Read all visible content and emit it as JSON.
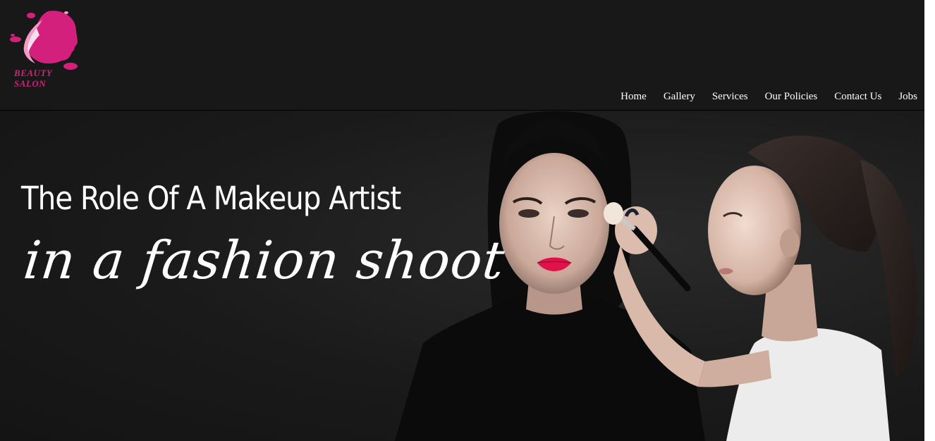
{
  "logo": {
    "icon": "woman-profile-icon",
    "line1": "BEAUTY",
    "line2": "SALON",
    "color": "#d2207c"
  },
  "nav": {
    "items": [
      "Home",
      "Gallery",
      "Services",
      "Our Policies",
      "Contact Us",
      "Jobs"
    ]
  },
  "hero": {
    "title": "The Role Of A Makeup Artist",
    "script": "in a fashion shoot",
    "image": "makeup-artist-applying-makeup-photo"
  }
}
